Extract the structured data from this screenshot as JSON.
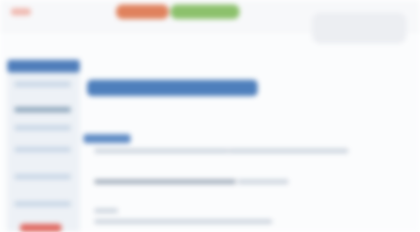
{
  "header": {
    "nav": [
      {
        "label": ""
      },
      {
        "label": ""
      }
    ],
    "search_placeholder": ""
  },
  "sidebar": {
    "title": "",
    "items": [
      {
        "label": ""
      },
      {
        "label": ""
      },
      {
        "label": ""
      },
      {
        "label": ""
      },
      {
        "label": ""
      },
      {
        "label": ""
      }
    ],
    "bottom_button": ""
  },
  "main": {
    "banner": "",
    "section_title": "",
    "paragraphs": [
      {
        "text": ""
      },
      {
        "text": ""
      },
      {
        "text": ""
      }
    ]
  }
}
